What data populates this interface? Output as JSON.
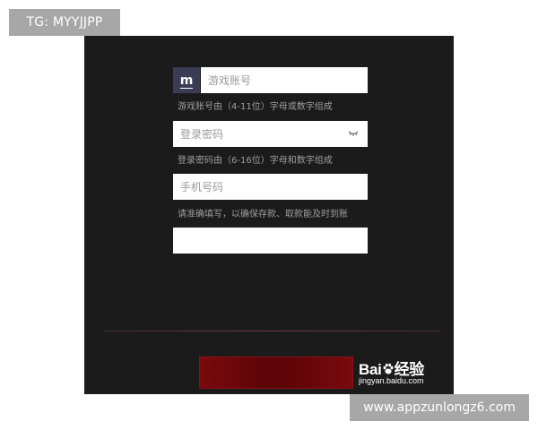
{
  "overlay": {
    "tg_label": "TG: MYYJJPP",
    "site_url": "www.appzunlongz6.com"
  },
  "form": {
    "account": {
      "prefix_letter": "m",
      "placeholder": "游戏账号",
      "value": "",
      "hint": "游戏账号由（4-11位）字母或数字组成"
    },
    "password": {
      "placeholder": "登录密码",
      "value": "",
      "hint": "登录密码由（6-16位）字母和数字组成"
    },
    "phone": {
      "placeholder": "手机号码",
      "value": "",
      "hint": "请准确填写，以确保存款、取款能及时到账"
    },
    "extra": {
      "placeholder": "",
      "value": ""
    },
    "submit_label": ""
  },
  "watermark": {
    "brand_prefix": "Bai",
    "brand_suffix": "经验",
    "url": "jingyan.baidu.com"
  },
  "colors": {
    "panel_bg": "#1c1b1c",
    "prefix_bg": "#3a3c56",
    "submit_red": "#6a0509",
    "badge_gray": "#a7a7a7"
  },
  "icons": {
    "password_toggle": "eye-closed-icon",
    "baidu_paw": "paw-icon"
  }
}
